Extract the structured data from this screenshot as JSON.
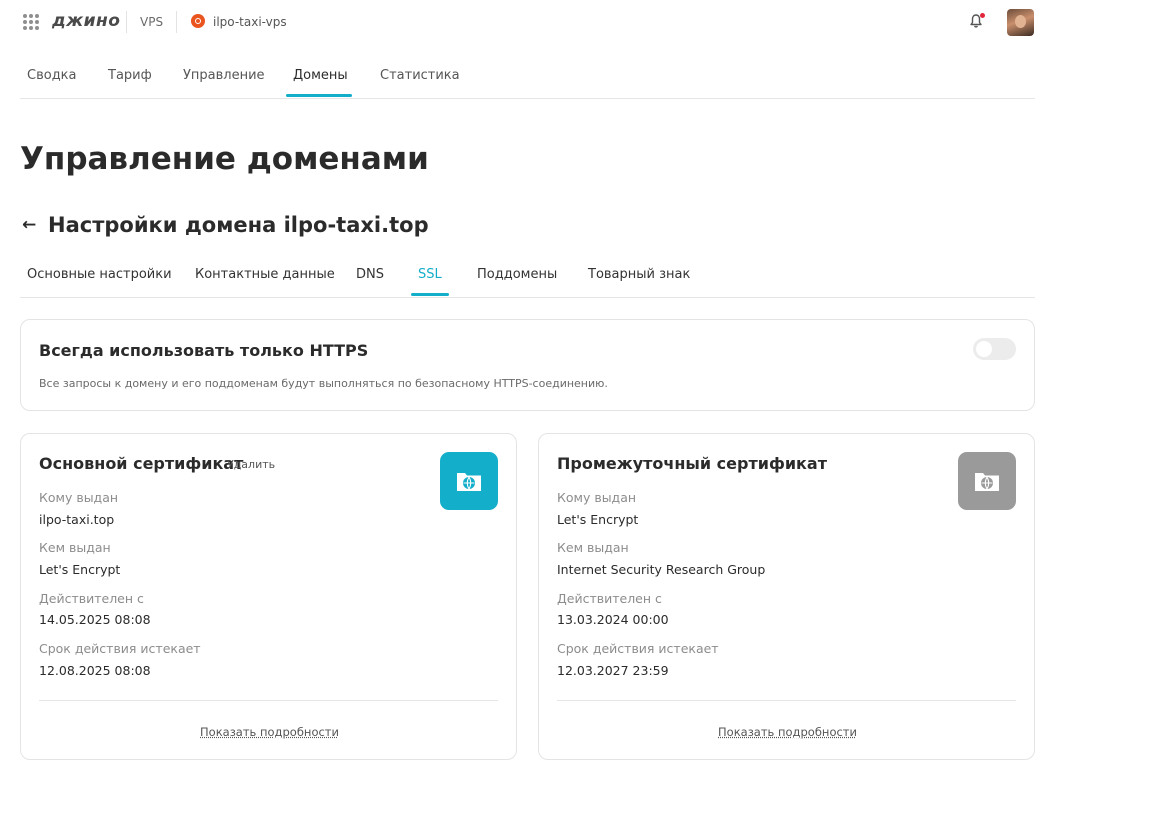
{
  "colors": {
    "accent": "#13aec9",
    "icon_gray": "#9a9a9a",
    "notification": "#e0263a",
    "ubuntu": "#e9541f"
  },
  "header": {
    "logo": "джино",
    "breadcrumb": {
      "vps": "VPS",
      "server": "ilpo-taxi-vps",
      "server_icon": "ubuntu-icon"
    },
    "icons": [
      "apps-grid-icon",
      "bell-icon"
    ]
  },
  "main_tabs": [
    {
      "label": "Сводка",
      "active": false
    },
    {
      "label": "Тариф",
      "active": false
    },
    {
      "label": "Управление",
      "active": false
    },
    {
      "label": "Домены",
      "active": true
    },
    {
      "label": "Статистика",
      "active": false
    }
  ],
  "page": {
    "title": "Управление доменами",
    "subtitle": "Настройки домена ilpo-taxi.top",
    "back_icon": "arrow-left-icon"
  },
  "sub_tabs": [
    {
      "label": "Основные настройки",
      "active": false
    },
    {
      "label": "Контактные данные",
      "active": false
    },
    {
      "label": "DNS",
      "active": false
    },
    {
      "label": "SSL",
      "active": true
    },
    {
      "label": "Поддомены",
      "active": false
    },
    {
      "label": "Товарный знак",
      "active": false
    }
  ],
  "https": {
    "title": "Всегда использовать только HTTPS",
    "description": "Все запросы к домену и его поддоменам будут выполняться по безопасному HTTPS-соединению.",
    "enabled": false
  },
  "certificates": {
    "primary": {
      "title": "Основной сертификат",
      "delete_label": "Удалить",
      "icon": "folder-globe-icon",
      "fields": [
        {
          "label": "Кому выдан",
          "value": "ilpo-taxi.top"
        },
        {
          "label": "Кем выдан",
          "value": "Let's Encrypt"
        },
        {
          "label": "Действителен с",
          "value": "14.05.2025 08:08"
        },
        {
          "label": "Срок действия истекает",
          "value": "12.08.2025 08:08"
        }
      ],
      "details_link": "Показать подробности"
    },
    "intermediate": {
      "title": "Промежуточный сертификат",
      "icon": "folder-globe-icon",
      "fields": [
        {
          "label": "Кому выдан",
          "value": "Let's Encrypt"
        },
        {
          "label": "Кем выдан",
          "value": "Internet Security Research Group"
        },
        {
          "label": "Действителен с",
          "value": "13.03.2024 00:00"
        },
        {
          "label": "Срок действия истекает",
          "value": "12.03.2027 23:59"
        }
      ],
      "details_link": "Показать подробности"
    }
  }
}
